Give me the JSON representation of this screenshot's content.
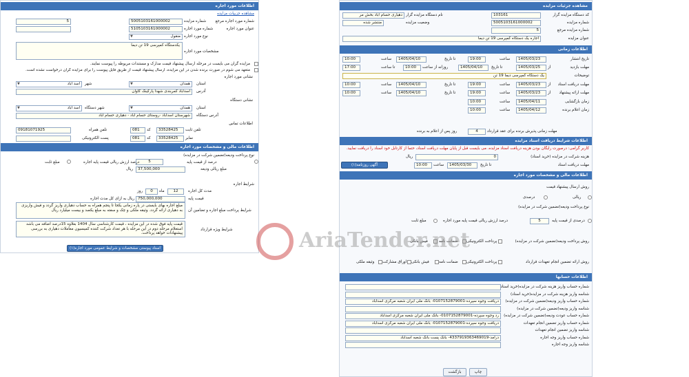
{
  "left": {
    "header": "اطلاعات مورد اجاره",
    "link_details": "مشاهده جزییات مزایده",
    "f_ref_no_label": "شماره مورد اجاره مرجع",
    "f_ref_no": "5",
    "f_auction_no_label": "شماره مزایده",
    "f_auction_no": "5005103161000002",
    "f_item_no_label": "شماره مورد اجاره",
    "f_item_no": "5105103161000002",
    "f_item_title_label": "عنوان مورد اجاره",
    "f_item_type_label": "نوع مورد اجاره",
    "f_item_type": "منقول",
    "f_spec_label": "مشخصات مورد اجاره",
    "f_spec": "یکدستگاه کمپرسی 19 تن دیما",
    "note1": "مزایده گران می بایست در مرحله ارسال پیشنهاد قیمت مدارک و مستندات مربوطه را پیوست نمایند.",
    "note2": "متعهد می شوم در صورت برنده شدن در این مزایده، ارسال پیشنهاد قیمت از طریق فایل پیوست را برای مزایده گران درخواست نشده است.",
    "addr_section_label": "نشانی مورد اجاره",
    "province_label": "استان",
    "province": "همدان",
    "city_label": "شهر",
    "city": "اسد آباد",
    "address_label": "آدرس",
    "address": "اسدآباد کمربندی شهدا پارکینگ کاوان",
    "org_section_label": "نشانی دستگاه",
    "org_province_label": "استان",
    "org_province": "همدان",
    "org_city_label": "شهر دستگاه",
    "org_city": "اسد آباد",
    "org_address_label": "آدرس دستگاه",
    "org_address": "شهرستان اسدآباد -روستای حسام اباد - دهیاری حسام اباد",
    "contact_label": "اطلاعات تماس",
    "phone_label": "تلفن ثابت",
    "phone": "33528425",
    "phone_code": "081",
    "code_label": "کد",
    "mobile_label": "تلفن همراه",
    "mobile": "09181071925",
    "fax_label": "نمابر",
    "fax": "33528425",
    "fax_code": "081",
    "email_label": "پست الکترونیکی",
    "fin_header": "اطلاعات مالی و مشخصات مورد اجاره",
    "deposit_type_label": "نوع پرداخت ودیعه(تضمین شرکت در مزایده)",
    "deposit_percent_label": "درصد از قیمت پایه",
    "deposit_percent": "5",
    "deposit_percent_note": "درصد ارزش ریالی قیمت پایه اجاره",
    "fixed_amount_label": "مبلغ ثابت",
    "deposit_amount_label": "مبلغ ریالی ودیعه",
    "deposit_amount": "37,500,000",
    "rial": "ریال",
    "terms_label": "شرایط اجاره",
    "duration_label": "مدت کل اجاره",
    "duration_month": "12",
    "duration_day": "0",
    "month": "ماه",
    "day": "روز",
    "base_price_label": "قیمت پایه",
    "base_price": "750,000,000",
    "base_price_note": "ریال به ازای کل مدت اجاره",
    "payment_terms_label": "شرایط پرداخت مبلغ اجاره و تضامین آن",
    "payment_terms": "مبلغ اجاره بهای بایستی در پاره زمانی یکجا تا پنجم همراه به حساب دهیاری واریز گردد و فیش واریزی به دهیاری ارائه گردد. وثیقه ملکی و چک و سفته به مبلغ یکصد و بیست میلیارد ریال",
    "special_terms_label": "شرایط ویژه قرارداد",
    "special_terms": "قیمت پایه فوق شده در این مزایده ، قیمت کارشناسی سال 1404 بعلاوه 15درصد اضافه می باشد استعلام مرحله دوم در این مرحله با هر تعداد شرکت کننده کمیسیون معاملات دهیاری به بررسی پیشنهادات خواهد پرداخت.",
    "attach_button": "اسناد پیوستی مشخصات و شرایط عمومی مورد اجاره(۱)"
  },
  "right": {
    "header": "مشاهده جزئیات مزایده",
    "org_code_label": "کد دستگاه مزایده گزار",
    "org_code": "103161",
    "org_name_label": "نام دستگاه مزایده گزار",
    "org_name": "دهیاری حسام اباد بخش مر",
    "auction_no_label": "شماره مزایده",
    "auction_no": "5005103161000002",
    "status_label": "وضعیت مزایده",
    "status": "منتشر شده",
    "ref_no_label": "شماره مزایده مرجع",
    "ref_no": "5",
    "title_label": "عنوان مزایده",
    "title": "اجاره یک دستگاه کمپرسی 19 تن دیما",
    "time_header": "اطلاعات زمانی",
    "publish_label": "تاریخ انتشار",
    "publish_date": "1405/03/23",
    "to_date_label": "تا تاریخ",
    "publish_to_date": "1405/04/10",
    "time_label": "ساعت",
    "publish_time": "19:00",
    "publish_to_time": "10:00",
    "visit_label": "مهلت بازدید",
    "from_label": "از",
    "visit_from": "1405/03/25",
    "visit_to": "1405/04/10",
    "visit_to_label": "تا تاریخ",
    "daily_from_label": "روزانه از ساعت",
    "daily_from": "10:00",
    "daily_to_label": "تا ساعت",
    "daily_to": "17:00",
    "desc_label": "توضیحات",
    "desc": "یک دستگاه کمپرسی دیما 19 تن",
    "doc_deadline_label": "مهلت دریافت اسناد",
    "doc_from": "1405/03/23",
    "doc_from_time": "19:00",
    "doc_to": "1405/04/10",
    "doc_to_time": "10:00",
    "offer_deadline_label": "مهلت ارائه پیشنهاد",
    "offer_from": "1405/03/23",
    "offer_from_time": "19:00",
    "offer_to": "1405/04/10",
    "offer_to_time": "10:00",
    "opening_label": "زمان بازگشایی",
    "opening_date": "1405/04/11",
    "opening_time": "10:00",
    "winner_label": "زمان اعلام برنده",
    "winner_date": "1405/04/12",
    "winner_time": "10:00",
    "validity_label": "مهلت زمانی پذیرش برنده برای عقد قرارداد",
    "validity_days": "4",
    "validity_note": "روز پس از اعلام به برنده",
    "docfee_header": "اطلاعات شرایط دریافت اسناد مزایده",
    "docfee_note": "کاربر گرامی: درصورت رایگان بودن هزینه دریافت اسناد مزایده، می بایست قبل از پایان مهلت دریافت اسناد، حتما از کارتابل خود اسناد را دریافت نمایید.",
    "docfee_label": "هزینه شرکت در مزایده (خرید اسناد)",
    "docfee": "0",
    "docfee_rial": "ریال",
    "doc_payment_deadline_label": "مهلت دریافت اسناد",
    "doc_payment_to": "1405/03/30",
    "doc_payment_time": "10:00",
    "newspaper_button": "آگهی روزنامه(۱)",
    "fin_header": "اطلاعات مالی و مشخصات مورد اجاره",
    "offer_method_label": "روش ارسال پیشنهاد قیمت",
    "rial_opt": "ریالی",
    "percent_opt": "درصدی",
    "deposit_type_label": "نوع پرداخت ودیعه(تضمین شرکت در مزایده)",
    "deposit_percent_label": "درصدی از قیمت پایه",
    "deposit_percent": "5",
    "deposit_percent_note": "درصد ارزش ریالی قیمت پایه مورد اجاره",
    "fixed_amount_label": "مبلغ ثابت",
    "pay_method_label": "روش پرداخت ودیعه(تضمین شرکت در مزایده)",
    "pay_opts": [
      "پرداخت الکترونیکی",
      "ضمانت نامه",
      "فیش بانکی"
    ],
    "guarantee_label": "روش ارائه تضمین انجام تعهدات قرارداد",
    "guarantee_opts": [
      "پرداخت الکترونیکی",
      "ضمانت نامه",
      "فیش بانکی",
      "اوراق مشارکت",
      "وثیقه ملکی"
    ],
    "acc_header": "اطلاعات حسابها",
    "acc_rows": [
      {
        "label": "شماره حساب واریز هزینه شرکت در مزایده(خرید اسناد)",
        "value": ""
      },
      {
        "label": "شناسه واریز هزینه شرکت در مزایده(خرید اسناد)",
        "value": ""
      },
      {
        "label": "شماره حساب واریز ودیعه(تضمین شرکت در مزایده)",
        "value": "دریافت وجوه سپرده-0107152879001- بانک ملی ایران شعبه مرکزی اسدآباد"
      },
      {
        "label": "شناسه واریز ودیعه(تضمین شرکت در مزایده)",
        "value": ""
      },
      {
        "label": "شماره حساب عودت ودیعه(تضمین شرکت در مزایده)",
        "value": "رد وجوه سپرده-0107152879001- بانک ملی ایران شعبه مرکزی اسدآباد"
      },
      {
        "label": "شماره حساب واریز تضمین انجام تعهدات",
        "value": "دریافت وجوه سپرده-0107152879001- بانک ملی ایران شعبه مرکزی اسدآباد"
      },
      {
        "label": "شناسه واریز تضمین انجام تعهدات",
        "value": ""
      },
      {
        "label": "شماره حساب واریز وجه اجاره",
        "value": "درآمد-4337919363469019- بانک پست بانک شعبه اسدآباد"
      },
      {
        "label": "شناسه واریز وجه اجاره",
        "value": ""
      }
    ],
    "print_button": "چاپ",
    "back_button": "بازگشت"
  },
  "watermark": "AriaTender.net"
}
